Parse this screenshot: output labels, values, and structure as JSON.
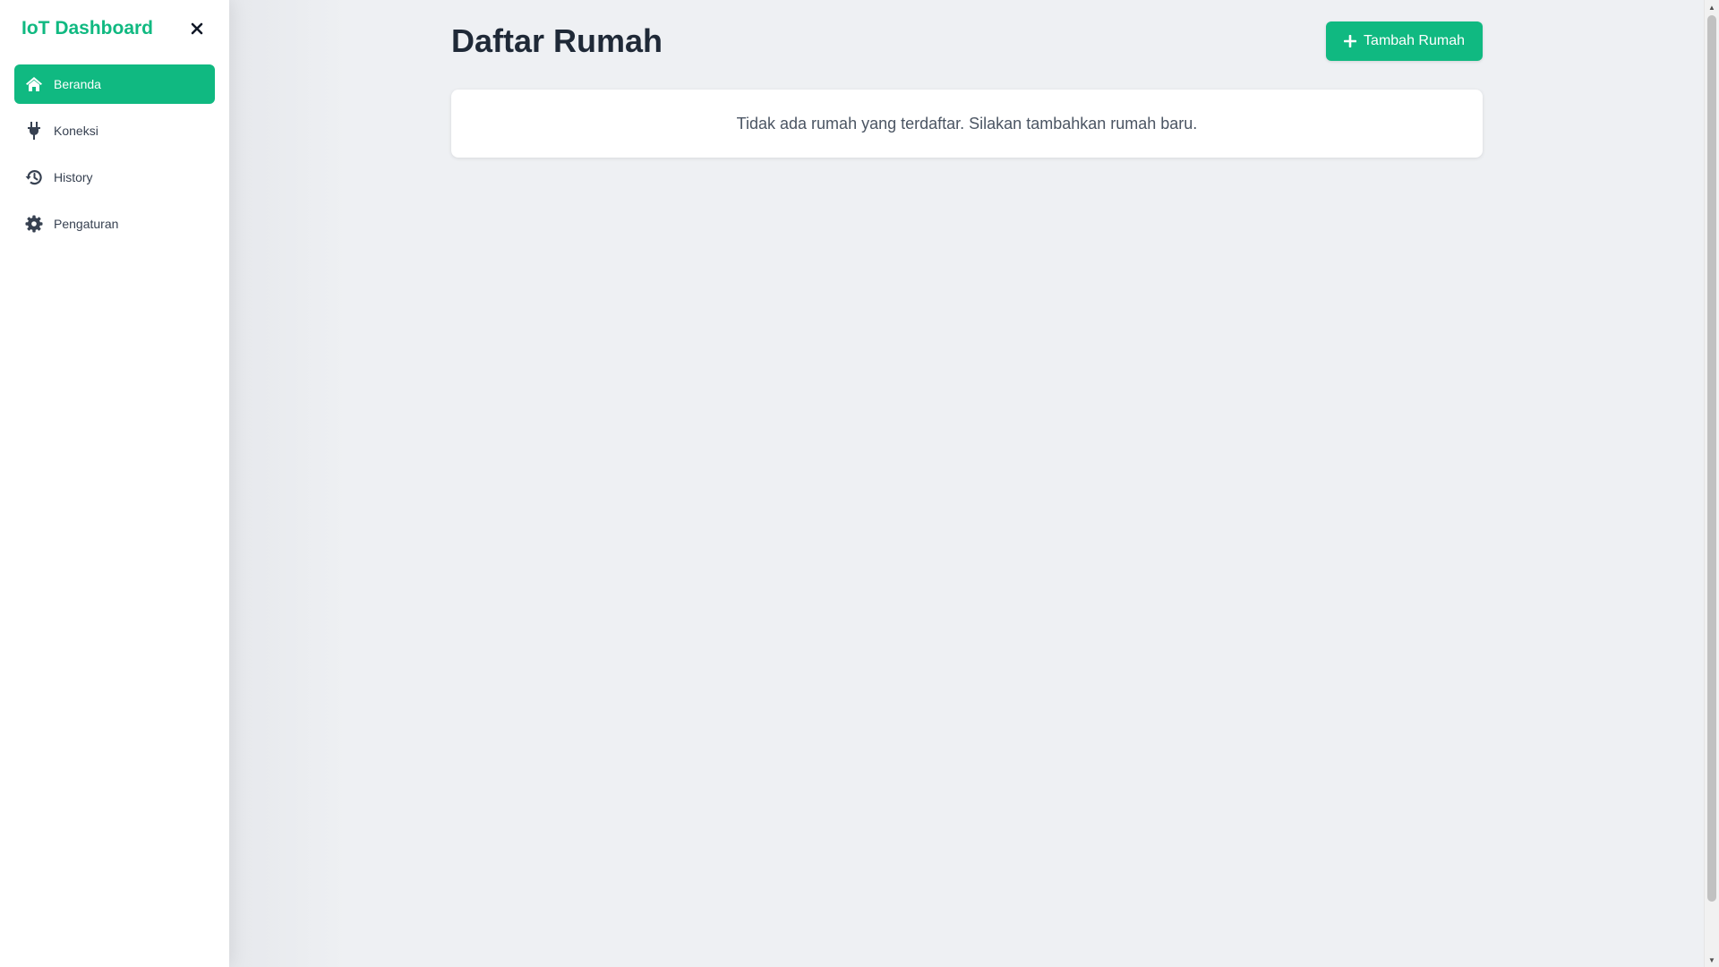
{
  "sidebar": {
    "brand": "IoT Dashboard",
    "close_icon": "close-icon",
    "items": [
      {
        "label": "Beranda",
        "icon": "home-icon",
        "active": true
      },
      {
        "label": "Koneksi",
        "icon": "plug-icon",
        "active": false
      },
      {
        "label": "History",
        "icon": "history-icon",
        "active": false
      },
      {
        "label": "Pengaturan",
        "icon": "gear-icon",
        "active": false
      }
    ]
  },
  "main": {
    "title": "Daftar Rumah",
    "add_button_label": "Tambah Rumah",
    "add_button_icon": "plus-icon",
    "empty_message": "Tidak ada rumah yang terdaftar. Silakan tambahkan rumah baru."
  },
  "colors": {
    "accent": "#10b981",
    "background": "#eef0f3",
    "text_dark": "#1f2937"
  }
}
